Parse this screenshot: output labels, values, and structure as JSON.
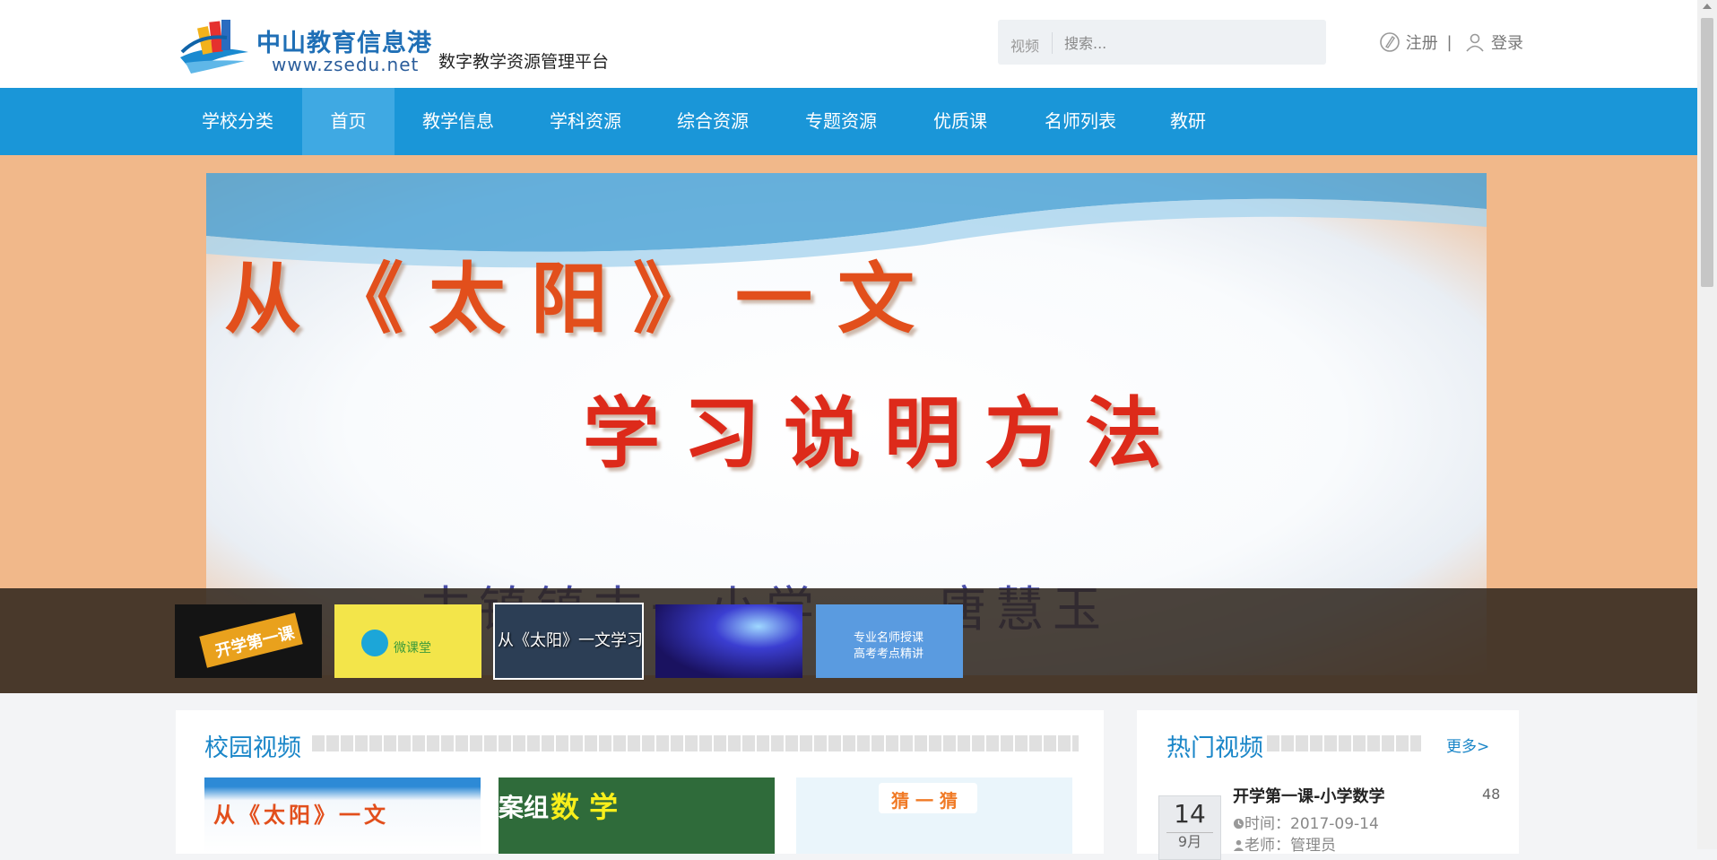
{
  "header": {
    "logo_title": "中山教育信息港",
    "logo_url": "www.zsedu.net",
    "platform_name": "数字教学资源管理平台"
  },
  "search": {
    "category": "视频",
    "placeholder": "搜索..."
  },
  "user": {
    "register": "注册",
    "separator": "|",
    "login": "登录"
  },
  "nav": {
    "items": [
      {
        "label": "学校分类"
      },
      {
        "label": "首页"
      },
      {
        "label": "教学信息"
      },
      {
        "label": "学科资源"
      },
      {
        "label": "综合资源"
      },
      {
        "label": "专题资源"
      },
      {
        "label": "优质课"
      },
      {
        "label": "名师列表"
      },
      {
        "label": "教研"
      }
    ],
    "active": "首页"
  },
  "banner": {
    "line1": "从《太阳》一文",
    "line2": "学习说明方法",
    "line3": "古镇镇古一小学　　唐慧玉"
  },
  "thumbnails": [
    {
      "text": "开学第一课"
    },
    {
      "text": "微课堂"
    },
    {
      "caption": "从《太阳》一文学习",
      "selected": true
    },
    {
      "text": ""
    },
    {
      "text_line1": "专业名师授课",
      "text_line2": "高考考点精讲"
    }
  ],
  "campus_videos": {
    "title": "校园视频",
    "items": [
      {
        "text": "从《太阳》一文"
      },
      {
        "text_prefix": "案组",
        "text": "数 学"
      },
      {
        "text": "猜 一 猜"
      }
    ]
  },
  "hot_videos": {
    "title": "热门视频",
    "more": "更多>",
    "items": [
      {
        "day": "14",
        "month": "9月",
        "title": "开学第一课-小学数学",
        "count": "48",
        "time": "时间：2017-09-14",
        "teacher": "老师：管理员"
      }
    ]
  },
  "colors": {
    "nav_bg": "#1a96d8",
    "nav_active": "#3fa9e3",
    "accent": "#1a86c8",
    "banner_bg": "#f1b88a"
  },
  "icons": {
    "register": "pen-circle-icon",
    "login": "user-icon",
    "time": "clock-icon",
    "teacher": "person-icon"
  }
}
